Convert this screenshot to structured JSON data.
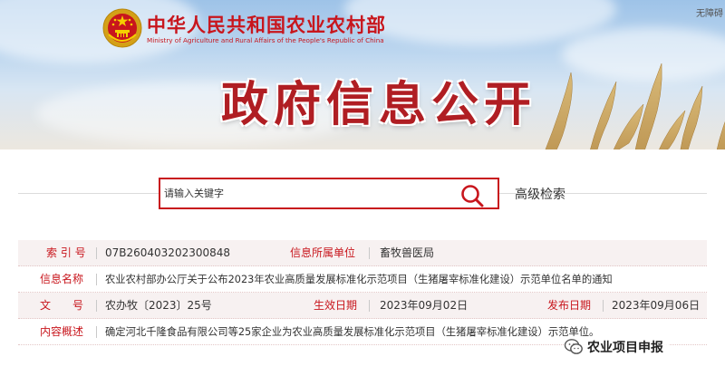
{
  "header": {
    "ministry_cn": "中华人民共和国农业农村部",
    "ministry_en": "Ministry of Agriculture and Rural Affairs of the People's Republic of China",
    "top_right_link": "无障碍",
    "banner_title": "政府信息公开"
  },
  "search": {
    "placeholder": "请输入关键字",
    "advanced_label": "高级检索",
    "icon": "search-icon"
  },
  "info": {
    "index_label": "索 引 号",
    "index_value": "07B260403202300848",
    "org_label": "信息所属单位",
    "org_value": "畜牧兽医局",
    "name_label": "信息名称",
    "name_value": "农业农村部办公厅关于公布2023年农业高质量发展标准化示范项目（生猪屠宰标准化建设）示范单位名单的通知",
    "doc_label": "文　　号",
    "doc_value": "农办牧〔2023〕25号",
    "date_label": "生效日期",
    "date_value": "2023年09月02日",
    "pub_label": "发布日期",
    "pub_value": "2023年09月06日",
    "summary_label": "内容概述",
    "summary_value": "确定河北千隆食品有限公司等25家企业为农业高质量发展标准化示范项目（生猪屠宰标准化建设）示范单位。"
  },
  "watermark": {
    "text": "农业项目申报",
    "icon": "wechat-icon"
  },
  "colors": {
    "brand_red": "#c8161d",
    "title_red": "#b01e23",
    "label_red": "#c8161d"
  }
}
